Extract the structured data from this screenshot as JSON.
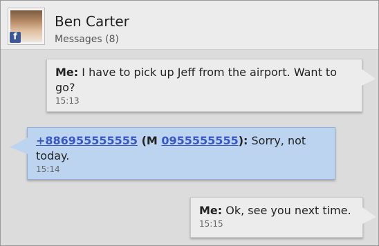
{
  "header": {
    "name": "Ben Carter",
    "subtitle": "Messages (8)",
    "avatar_badge": "f"
  },
  "messages": [
    {
      "sender": "Me:",
      "text": " I have to pick up Jeff from the airport. Want to go?",
      "time": "15:13",
      "direction": "outgoing"
    },
    {
      "number": "+886955555555",
      "paren_open": " (M ",
      "number2": "0955555555",
      "paren_close": "):",
      "text": " Sorry, not today.",
      "time": "15:14",
      "direction": "incoming"
    },
    {
      "sender": "Me:",
      "text": " Ok, see you next time.",
      "time": "15:15",
      "direction": "outgoing"
    }
  ],
  "colors": {
    "incoming_bubble": "#bcd4ef",
    "outgoing_bubble": "#ececec",
    "link": "#3a57c8",
    "background": "#dcdcdc"
  }
}
